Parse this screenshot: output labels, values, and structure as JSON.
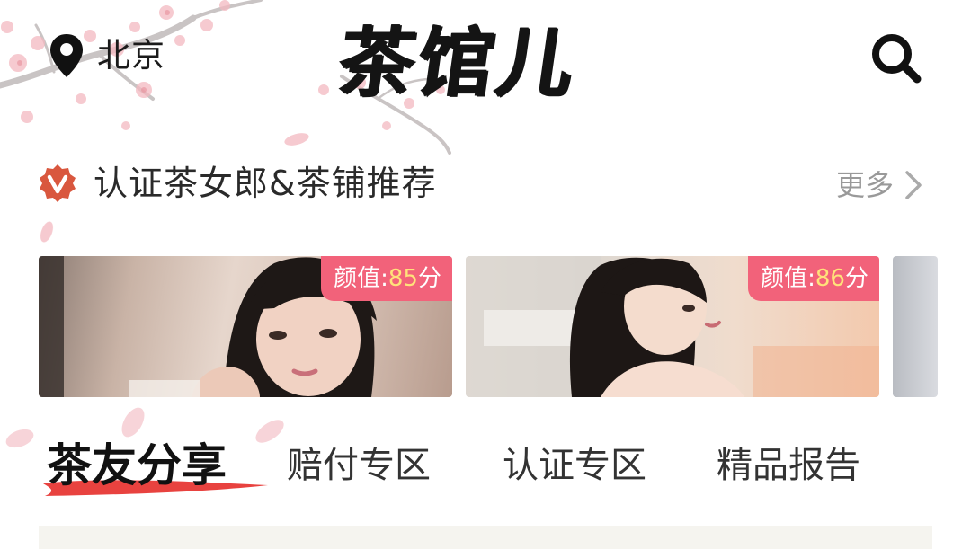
{
  "header": {
    "location": "北京",
    "logo_text": "茶馆儿",
    "location_icon": "map-pin-icon",
    "search_icon": "search-icon"
  },
  "recommend_section": {
    "title": "认证茶女郎&茶铺推荐",
    "more_label": "更多",
    "badge_icon": "verified-v-badge-icon",
    "cards": [
      {
        "score_label": "颜值:",
        "score_value": "85",
        "score_unit": "分"
      },
      {
        "score_label": "颜值:",
        "score_value": "86",
        "score_unit": "分"
      }
    ]
  },
  "tabs": [
    {
      "label": "茶友分享",
      "active": true
    },
    {
      "label": "赔付专区",
      "active": false
    },
    {
      "label": "认证专区",
      "active": false
    },
    {
      "label": "精品报告",
      "active": false
    }
  ],
  "colors": {
    "accent": "#e8423f",
    "badge_bg": "#f2627a",
    "score_value": "#ffe27a",
    "verified_badge": "#d9573e",
    "panel_bg": "#f5f4ef"
  }
}
